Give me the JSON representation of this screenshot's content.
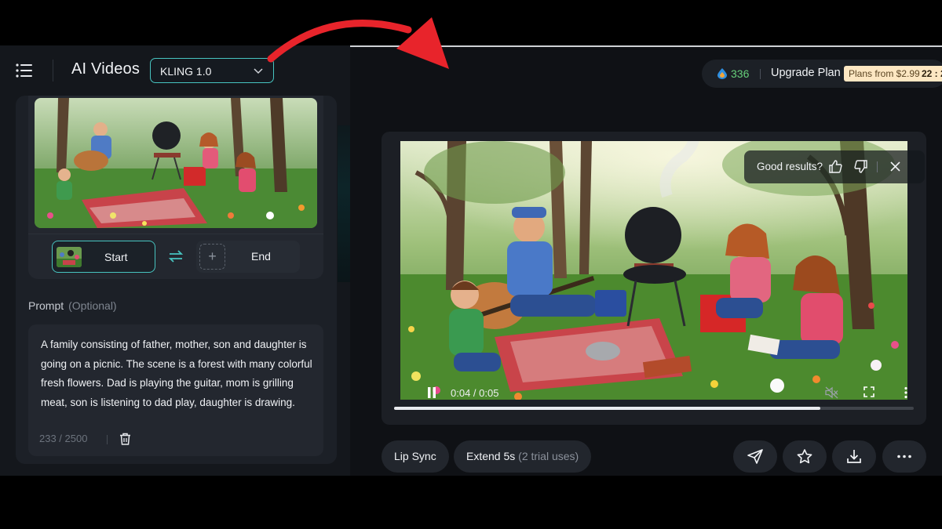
{
  "header": {
    "title": "AI Videos",
    "model_selected": "KLING 1.0"
  },
  "frames": {
    "start_label": "Start",
    "end_label": "End"
  },
  "prompt": {
    "label": "Prompt",
    "optional": "(Optional)",
    "text": "A family consisting of father, mother, son and daughter is going on a picnic. The scene is a forest with many colorful fresh flowers. Dad is playing the guitar, mom is grilling meat, son is listening to dad play, daughter is drawing.",
    "counter": "233 / 2500"
  },
  "account": {
    "credits": "336",
    "upgrade_label": "Upgrade Plan",
    "promo": "Plans from $2.99",
    "promo_timer": "22 : 2"
  },
  "player": {
    "feedback_prompt": "Good results?",
    "time": "0:04 / 0:05",
    "progress": 0.82
  },
  "actions": {
    "lip_sync": "Lip Sync",
    "extend": "Extend 5s",
    "extend_note": "(2 trial uses)"
  },
  "icons": {
    "menu": "menu-icon",
    "chevron": "chevron-down-icon",
    "swap": "swap-icon",
    "trash": "trash-icon",
    "credit": "drop-icon",
    "thumbs_up": "thumbs-up-icon",
    "thumbs_down": "thumbs-down-icon",
    "close": "close-icon",
    "pause": "pause-icon",
    "mute": "mute-icon",
    "fullscreen": "fullscreen-icon",
    "more": "more-vertical-icon",
    "share": "send-icon",
    "favorite": "star-icon",
    "download": "download-icon",
    "more_horizontal": "more-horizontal-icon"
  },
  "colors": {
    "accent": "#47c4c0",
    "credits": "#66d07a",
    "annotation_arrow": "#e8242b"
  }
}
